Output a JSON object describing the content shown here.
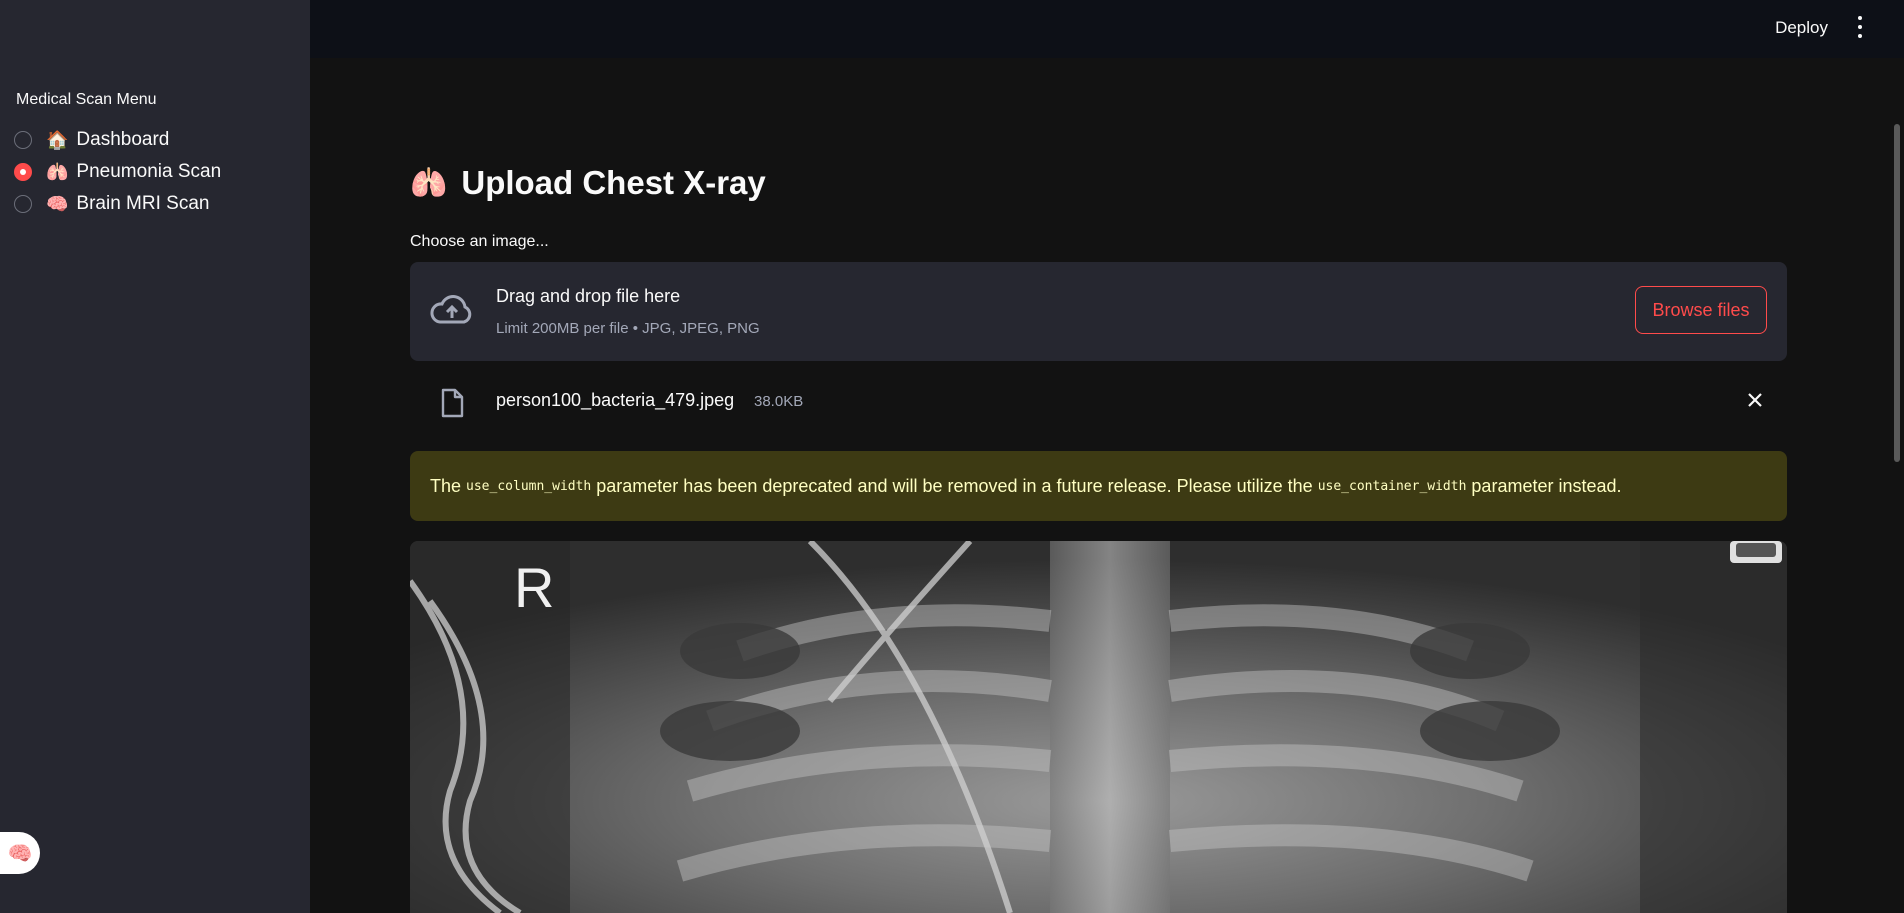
{
  "sidebar": {
    "menu_title": "Medical Scan Menu",
    "items": [
      {
        "emoji": "🏠",
        "label": "Dashboard",
        "selected": false
      },
      {
        "emoji": "🫁",
        "label": "Pneumonia Scan",
        "selected": true
      },
      {
        "emoji": "🧠",
        "label": "Brain MRI Scan",
        "selected": false
      }
    ],
    "fab_emoji": "🧠"
  },
  "topbar": {
    "deploy_label": "Deploy",
    "menu_icon": "kebab-menu-icon"
  },
  "main": {
    "title_emoji": "🫁",
    "title": "Upload Chest X-ray",
    "uploader_label": "Choose an image...",
    "dropzone": {
      "main_text": "Drag and drop file here",
      "sub_text": "Limit 200MB per file • JPG, JPEG, PNG",
      "browse_label": "Browse files",
      "icon": "cloud-upload-icon"
    },
    "file": {
      "name": "person100_bacteria_479.jpeg",
      "size": "38.0KB",
      "icon": "file-icon"
    },
    "warning": {
      "part1": "The",
      "code1": "use_column_width",
      "part2": "parameter has been deprecated and will be removed in a future release. Please utilize the",
      "code2": "use_container_width",
      "part3": "parameter instead."
    },
    "image": {
      "marker_text": "R"
    }
  },
  "colors": {
    "accent": "#ff4b4b",
    "sidebar_bg": "#262730",
    "main_bg": "#121212",
    "warning_bg": "#3d3a13",
    "warning_text": "#ffffc2"
  }
}
